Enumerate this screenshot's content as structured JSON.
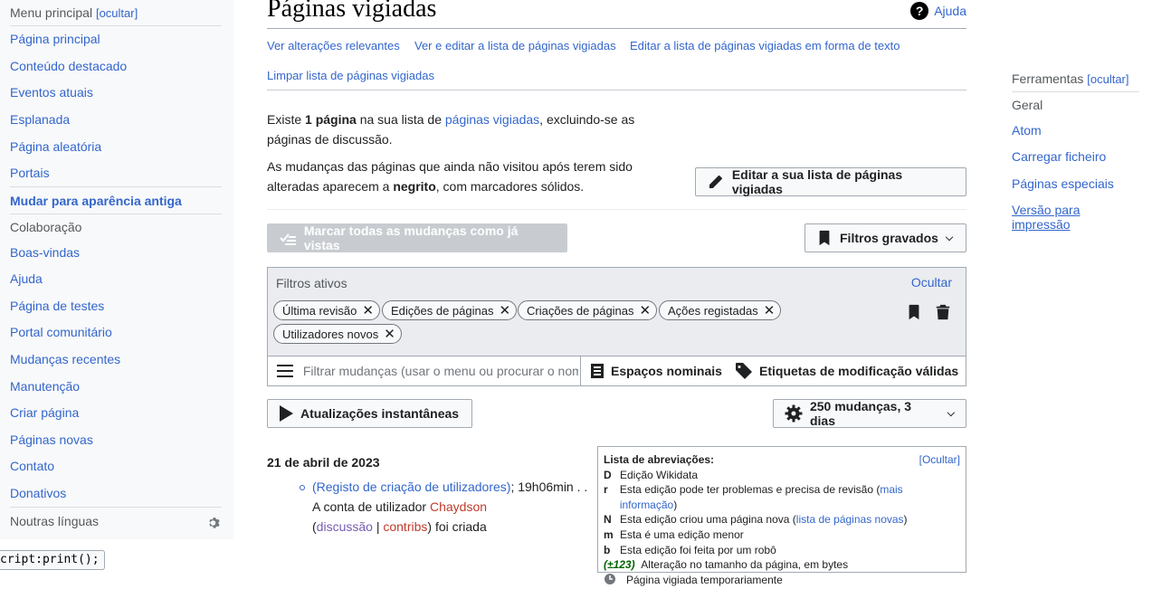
{
  "sidebar": {
    "main_heading": "Menu principal",
    "hide_label": "[ocultar]",
    "nav_items": [
      "Página principal",
      "Conteúdo destacado",
      "Eventos atuais",
      "Esplanada",
      "Página aleatória",
      "Portais"
    ],
    "switch_skin": "Mudar para aparência antiga",
    "collab_heading": "Colaboração",
    "collab_items": [
      "Boas-vindas",
      "Ajuda",
      "Página de testes",
      "Portal comunitário",
      "Mudanças recentes",
      "Manutenção",
      "Criar página",
      "Páginas novas",
      "Contato",
      "Donativos"
    ],
    "languages_label": "Noutras línguas"
  },
  "page": {
    "title": "Páginas vigiadas",
    "help_label": "Ajuda",
    "top_links": [
      "Ver alterações relevantes",
      "Ver e editar a lista de páginas vigiadas",
      "Editar a lista de páginas vigiadas em forma de texto",
      "Limpar lista de páginas vigiadas"
    ],
    "intro": {
      "p1_pre": "Existe ",
      "p1_bold": "1 página",
      "p1_mid": " na sua lista de ",
      "p1_link": "páginas vigiadas",
      "p1_post": ", excluindo-se as páginas de discussão.",
      "p2_pre": "As mudanças das páginas que ainda não visitou após terem sido alteradas aparecem a ",
      "p2_bold": "negrito",
      "p2_post": ", com marcadores sólidos."
    },
    "edit_list_button": "Editar a sua lista de páginas vigiadas",
    "mark_all_button": "Marcar todas as mudanças como já vistas",
    "saved_filters_button": "Filtros gravados"
  },
  "filters": {
    "label": "Filtros ativos",
    "hide_label": "Ocultar",
    "tags": [
      "Última revisão",
      "Edições de páginas",
      "Criações de páginas",
      "Ações registadas",
      "Utilizadores novos"
    ],
    "search_placeholder": "Filtrar mudanças (usar o menu ou procurar o nome do filtro)",
    "namespaces_button": "Espaços nominais",
    "tags_button": "Etiquetas de modificação válidas"
  },
  "controls": {
    "live_updates": "Atualizações instantâneas",
    "results_options": "250 mudanças, 3 dias"
  },
  "changes": {
    "date": "21 de abril de 2023",
    "entry": {
      "log_link": "(Registo de criação de utilizadores)",
      "time": "; 19h06min . . A conta de utilizador ",
      "user": "Chaydson",
      "open_paren": "(",
      "talk": "discussão",
      "pipe": " | ",
      "contribs": "contribs",
      "tail": ") foi criada"
    }
  },
  "legend": {
    "title": "Lista de abreviações:",
    "hide": "[Ocultar]",
    "rows": [
      {
        "code": "D",
        "text": "Edição Wikidata"
      },
      {
        "code": "r",
        "text": "Esta edição pode ter problemas e precisa de revisão (",
        "link": "mais informação",
        "after": ")"
      },
      {
        "code": "N",
        "text": "Esta edição criou uma página nova (",
        "link": "lista de páginas novas",
        "after": ")"
      },
      {
        "code": "m",
        "text": "Esta é uma edição menor"
      },
      {
        "code": "b",
        "text": "Esta edição foi feita por um robô"
      }
    ],
    "size_code": "(±123)",
    "size_text": "Alteração no tamanho da página, em bytes",
    "temp_text": "Página vigiada temporariamente"
  },
  "tools": {
    "heading": "Ferramentas",
    "hide_label": "[ocultar]",
    "general": "Geral",
    "items": [
      "Atom",
      "Carregar ficheiro",
      "Páginas especiais"
    ],
    "print_line1": "Versão para",
    "print_line2": "impressão"
  },
  "statusbar": {
    "text": "cript:print();"
  }
}
